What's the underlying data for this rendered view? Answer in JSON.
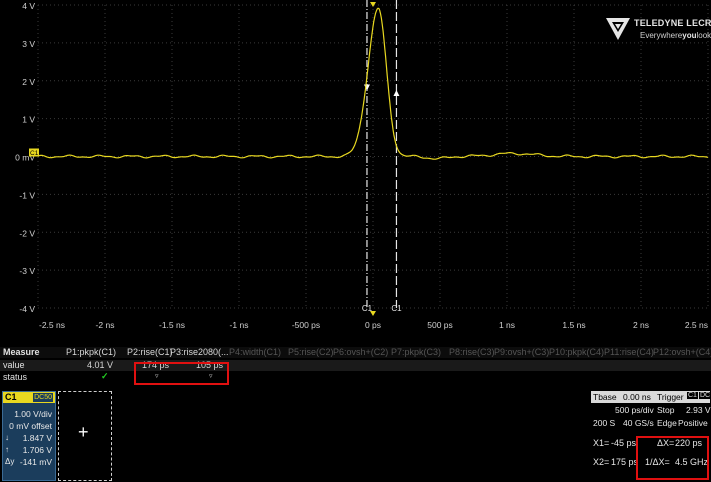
{
  "scope": {
    "y_labels": [
      "4 V",
      "3 V",
      "2 V",
      "1 V",
      "0 mV",
      "-1 V",
      "-2 V",
      "-3 V",
      "-4 V"
    ],
    "x_labels": [
      "-2.5 ns",
      "-2 ns",
      "-1.5 ns",
      "-1 ns",
      "-500 ps",
      "0 ps",
      "500 ps",
      "1 ns",
      "1.5 ns",
      "2 ns",
      "2.5 ns"
    ],
    "channel_marker": "C1",
    "cursor_labels": [
      "C1",
      "C1"
    ],
    "trace_color": "#e8d820",
    "grid_color": "#3a3a3a"
  },
  "logo": {
    "brand": "TELEDYNE LECROY",
    "tag_a": "Everywhere",
    "tag_b": "you",
    "tag_c": "look"
  },
  "measure": {
    "title": "Measure",
    "value_label": "value",
    "status_label": "status",
    "params": [
      "P1:pkpk(C1)",
      "P2:rise(C1)",
      "P3:rise2080(...",
      "P4:width(C1)",
      "P5:rise(C2)",
      "P6:ovsh+(C2)",
      "P7:pkpk(C3)",
      "P8:rise(C3)",
      "P9:ovsh+(C3)",
      "P10:pkpk(C4)",
      "P11:rise(C4)",
      "P12:ovsh+(C4)"
    ],
    "values": [
      "4.01 V",
      "174 ps",
      "105 ps"
    ],
    "status_mark": "✓",
    "warn_mark": "▿"
  },
  "channel": {
    "name": "C1",
    "coupling": "DC50",
    "vdiv": "1.00 V/div",
    "offset": "0 mV offset",
    "down_sym": "↓",
    "down_val": "1.847 V",
    "up_sym": "↑",
    "up_val": "1.706 V",
    "dy_sym": "Δy",
    "dy_val": "-141 mV"
  },
  "zoom": {
    "plus": "+"
  },
  "timebase": {
    "label": "Tbase",
    "delay": "0.00 ns",
    "trigger_label": "Trigger",
    "trig_src": "C1",
    "trig_cpl": "DC",
    "tdiv": "500 ps/div",
    "samples": "200 S",
    "rate": "40 GS/s",
    "mode": "Stop",
    "level": "2.93 V",
    "type": "Edge",
    "slope": "Positive"
  },
  "cursors": {
    "x1_label": "X1=",
    "x1_val": "-45 ps",
    "x2_label": "X2=",
    "x2_val": "175 ps",
    "dx_label": "ΔX=",
    "dx_val": "220 ps",
    "inv_label": "1/ΔX=",
    "inv_val": "4.5 GHz"
  }
}
